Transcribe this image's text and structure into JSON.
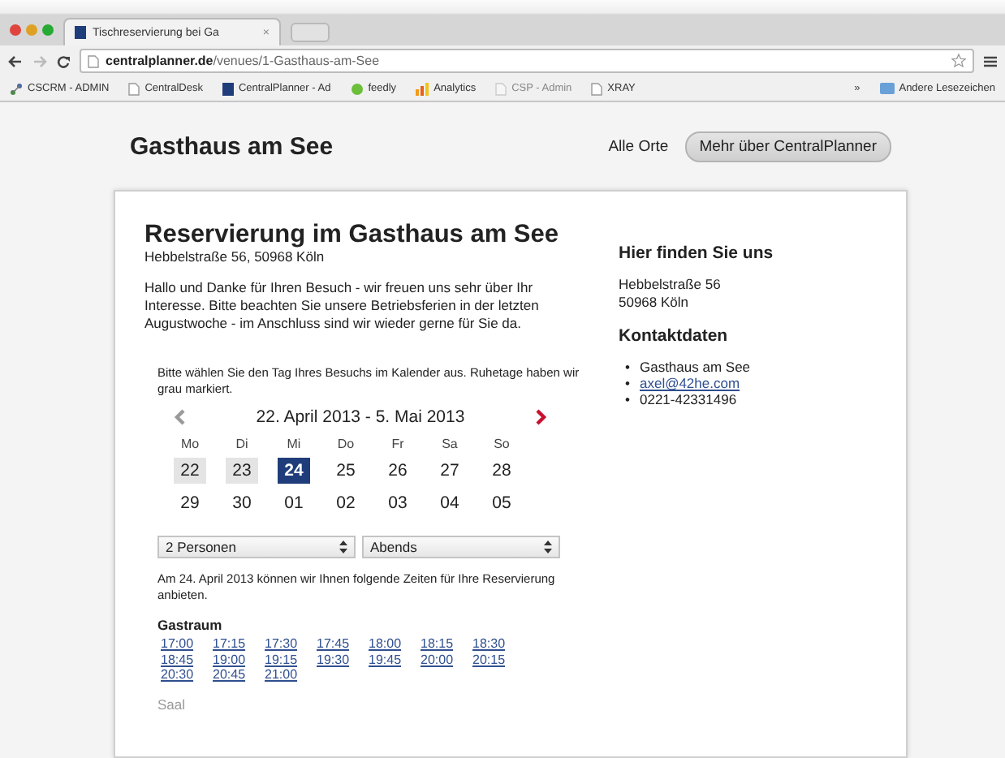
{
  "browser": {
    "tab_title": "Tischreservierung bei Ga",
    "tab_close": "×",
    "url": "**centralplanner.de**/venues/1-Gasthaus-am-See",
    "bookmarks": [
      {
        "label": "CSCRM - ADMIN",
        "kind": "network"
      },
      {
        "label": "CentralDesk",
        "kind": "page"
      },
      {
        "label": "CentralPlanner - Ad",
        "kind": "square"
      },
      {
        "label": "feedly",
        "kind": "leaf"
      },
      {
        "label": "Analytics",
        "kind": "chart"
      },
      {
        "label": "CSP - Admin",
        "kind": "faint"
      },
      {
        "label": "XRAY",
        "kind": "page"
      }
    ],
    "more": "»",
    "other_bookmarks": "Andere Lesezeichen"
  },
  "header": {
    "brand": "Gasthaus am See",
    "nav": [
      {
        "label": "Alle Orte",
        "kind": "link"
      },
      {
        "label": "Mehr über CentralPlanner",
        "kind": "button"
      }
    ]
  },
  "main": {
    "title": "Reservierung im Gasthaus am See",
    "address": "Hebbelstraße 56, 50968 Köln",
    "intro": "Hallo und Danke für Ihren Besuch - wir freuen uns sehr über Ihr Interesse. Bitte beachten Sie unsere Betriebsferien in der letzten Augustwoche - im Anschluss sind wir wieder gerne für Sie da.",
    "calendar_hint": "Bitte wählen Sie den Tag Ihres Besuchs im Kalender aus. Ruhetage haben wir grau markiert.",
    "calendar": {
      "range": "22. April 2013 - 5. Mai 2013",
      "prev_enabled": false,
      "next_enabled": true,
      "weekdays": [
        "Mo",
        "Di",
        "Mi",
        "Do",
        "Fr",
        "Sa",
        "So"
      ],
      "weeks": [
        [
          {
            "day": "22",
            "closed": true,
            "selected": false
          },
          {
            "day": "23",
            "closed": true,
            "selected": false
          },
          {
            "day": "24",
            "closed": false,
            "selected": true
          },
          {
            "day": "25",
            "closed": false,
            "selected": false
          },
          {
            "day": "26",
            "closed": false,
            "selected": false
          },
          {
            "day": "27",
            "closed": false,
            "selected": false
          },
          {
            "day": "28",
            "closed": false,
            "selected": false
          }
        ],
        [
          {
            "day": "29",
            "closed": false,
            "selected": false
          },
          {
            "day": "30",
            "closed": false,
            "selected": false
          },
          {
            "day": "01",
            "closed": false,
            "selected": false
          },
          {
            "day": "02",
            "closed": false,
            "selected": false
          },
          {
            "day": "03",
            "closed": false,
            "selected": false
          },
          {
            "day": "04",
            "closed": false,
            "selected": false
          },
          {
            "day": "05",
            "closed": false,
            "selected": false
          }
        ]
      ]
    },
    "selects": [
      {
        "value": "2 Personen"
      },
      {
        "value": "Abends"
      }
    ],
    "availability": "Am 24. April 2013 können wir Ihnen folgende Zeiten für Ihre Reservierung anbieten.",
    "rooms": [
      {
        "name": "Gastraum",
        "times": [
          "17:00",
          "17:15",
          "17:30",
          "17:45",
          "18:00",
          "18:15",
          "18:30",
          "18:45",
          "19:00",
          "19:15",
          "19:30",
          "19:45",
          "20:00",
          "20:15",
          "20:30",
          "20:45",
          "21:00"
        ]
      },
      {
        "name": "Saal"
      }
    ]
  },
  "sidebar": {
    "location_title": "Hier finden Sie uns",
    "location_lines": [
      "Hebbelstraße 56",
      "50968 Köln"
    ],
    "contact_title": "Kontaktdaten",
    "contacts": [
      {
        "bullet": "•",
        "text": "Gasthaus am See",
        "kind": "text"
      },
      {
        "bullet": "•",
        "text": "axel@42he.com",
        "kind": "link"
      },
      {
        "bullet": "•",
        "text": "0221-42331496",
        "kind": "text"
      }
    ]
  }
}
